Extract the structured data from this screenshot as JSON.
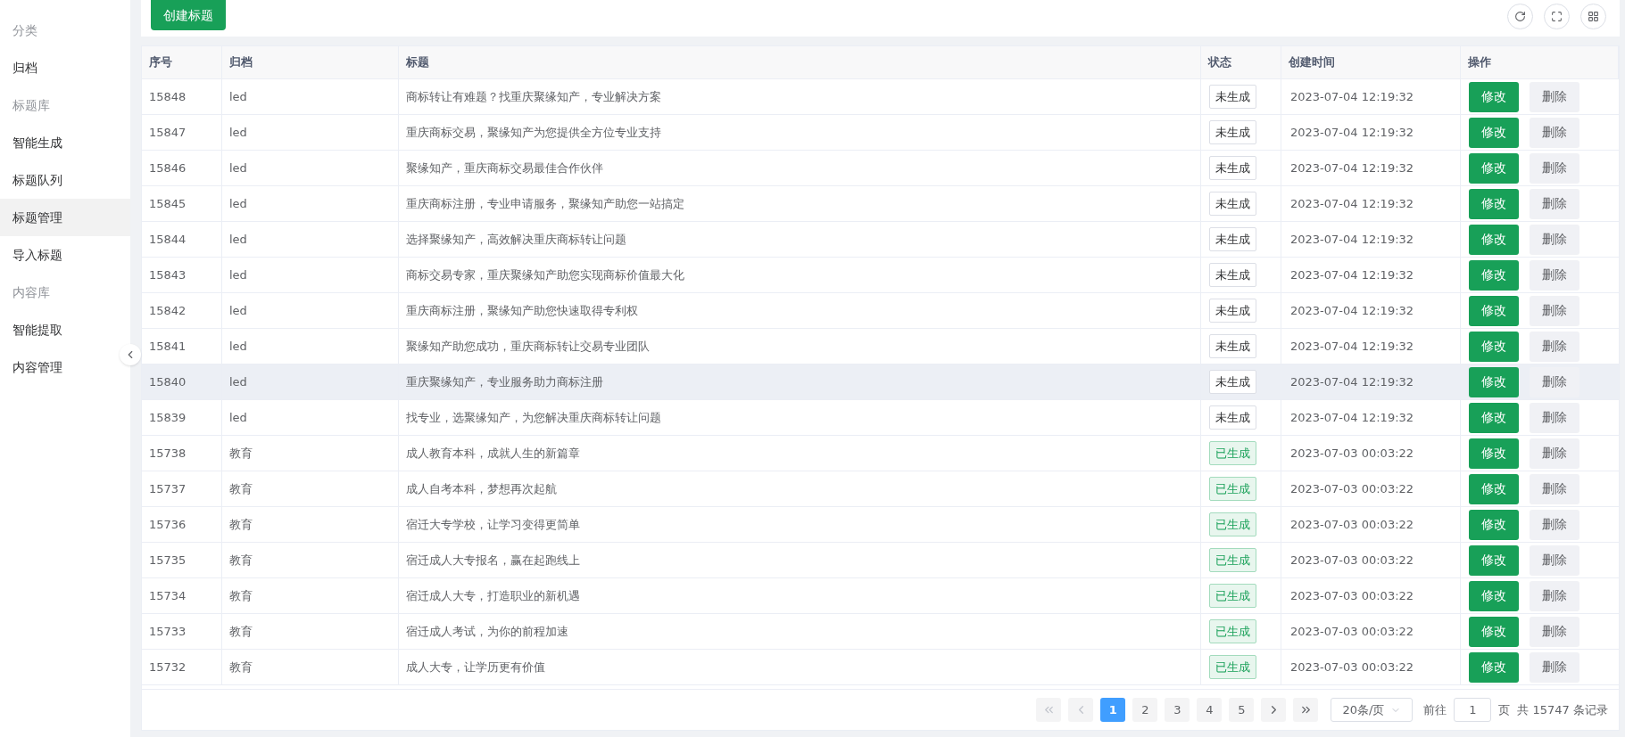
{
  "sidebar": {
    "items": [
      {
        "kind": "group",
        "label": "分类",
        "selected": false
      },
      {
        "kind": "item",
        "label": "归档",
        "selected": false
      },
      {
        "kind": "group",
        "label": "标题库",
        "selected": false
      },
      {
        "kind": "item",
        "label": "智能生成",
        "selected": false
      },
      {
        "kind": "item",
        "label": "标题队列",
        "selected": false
      },
      {
        "kind": "item",
        "label": "标题管理",
        "selected": true
      },
      {
        "kind": "item",
        "label": "导入标题",
        "selected": false
      },
      {
        "kind": "group",
        "label": "内容库",
        "selected": false
      },
      {
        "kind": "item",
        "label": "智能提取",
        "selected": false
      },
      {
        "kind": "item",
        "label": "内容管理",
        "selected": false
      }
    ]
  },
  "toolbar": {
    "create_button": "创建标题"
  },
  "table": {
    "columns": [
      "序号",
      "归档",
      "标题",
      "状态",
      "创建时间",
      "操作"
    ],
    "rows": [
      {
        "id": "15848",
        "archive": "led",
        "title": "商标转让有难题？找重庆聚缘知产，专业解决方案",
        "status": "未生成",
        "generated": false,
        "created": "2023-07-04 12:19:32",
        "edit": "修改",
        "delete": "删除",
        "highlighted": false
      },
      {
        "id": "15847",
        "archive": "led",
        "title": "重庆商标交易，聚缘知产为您提供全方位专业支持",
        "status": "未生成",
        "generated": false,
        "created": "2023-07-04 12:19:32",
        "edit": "修改",
        "delete": "删除",
        "highlighted": false
      },
      {
        "id": "15846",
        "archive": "led",
        "title": "聚缘知产，重庆商标交易最佳合作伙伴",
        "status": "未生成",
        "generated": false,
        "created": "2023-07-04 12:19:32",
        "edit": "修改",
        "delete": "删除",
        "highlighted": false
      },
      {
        "id": "15845",
        "archive": "led",
        "title": "重庆商标注册，专业申请服务，聚缘知产助您一站搞定",
        "status": "未生成",
        "generated": false,
        "created": "2023-07-04 12:19:32",
        "edit": "修改",
        "delete": "删除",
        "highlighted": false
      },
      {
        "id": "15844",
        "archive": "led",
        "title": "选择聚缘知产，高效解决重庆商标转让问题",
        "status": "未生成",
        "generated": false,
        "created": "2023-07-04 12:19:32",
        "edit": "修改",
        "delete": "删除",
        "highlighted": false
      },
      {
        "id": "15843",
        "archive": "led",
        "title": "商标交易专家，重庆聚缘知产助您实现商标价值最大化",
        "status": "未生成",
        "generated": false,
        "created": "2023-07-04 12:19:32",
        "edit": "修改",
        "delete": "删除",
        "highlighted": false
      },
      {
        "id": "15842",
        "archive": "led",
        "title": "重庆商标注册，聚缘知产助您快速取得专利权",
        "status": "未生成",
        "generated": false,
        "created": "2023-07-04 12:19:32",
        "edit": "修改",
        "delete": "删除",
        "highlighted": false
      },
      {
        "id": "15841",
        "archive": "led",
        "title": "聚缘知产助您成功，重庆商标转让交易专业团队",
        "status": "未生成",
        "generated": false,
        "created": "2023-07-04 12:19:32",
        "edit": "修改",
        "delete": "删除",
        "highlighted": false
      },
      {
        "id": "15840",
        "archive": "led",
        "title": "重庆聚缘知产，专业服务助力商标注册",
        "status": "未生成",
        "generated": false,
        "created": "2023-07-04 12:19:32",
        "edit": "修改",
        "delete": "删除",
        "highlighted": true
      },
      {
        "id": "15839",
        "archive": "led",
        "title": "找专业，选聚缘知产，为您解决重庆商标转让问题",
        "status": "未生成",
        "generated": false,
        "created": "2023-07-04 12:19:32",
        "edit": "修改",
        "delete": "删除",
        "highlighted": false
      },
      {
        "id": "15738",
        "archive": "教育",
        "title": "成人教育本科，成就人生的新篇章",
        "status": "已生成",
        "generated": true,
        "created": "2023-07-03 00:03:22",
        "edit": "修改",
        "delete": "删除",
        "highlighted": false
      },
      {
        "id": "15737",
        "archive": "教育",
        "title": "成人自考本科，梦想再次起航",
        "status": "已生成",
        "generated": true,
        "created": "2023-07-03 00:03:22",
        "edit": "修改",
        "delete": "删除",
        "highlighted": false
      },
      {
        "id": "15736",
        "archive": "教育",
        "title": "宿迁大专学校，让学习变得更简单",
        "status": "已生成",
        "generated": true,
        "created": "2023-07-03 00:03:22",
        "edit": "修改",
        "delete": "删除",
        "highlighted": false
      },
      {
        "id": "15735",
        "archive": "教育",
        "title": "宿迁成人大专报名，赢在起跑线上",
        "status": "已生成",
        "generated": true,
        "created": "2023-07-03 00:03:22",
        "edit": "修改",
        "delete": "删除",
        "highlighted": false
      },
      {
        "id": "15734",
        "archive": "教育",
        "title": "宿迁成人大专，打造职业的新机遇",
        "status": "已生成",
        "generated": true,
        "created": "2023-07-03 00:03:22",
        "edit": "修改",
        "delete": "删除",
        "highlighted": false
      },
      {
        "id": "15733",
        "archive": "教育",
        "title": "宿迁成人考试，为你的前程加速",
        "status": "已生成",
        "generated": true,
        "created": "2023-07-03 00:03:22",
        "edit": "修改",
        "delete": "删除",
        "highlighted": false
      },
      {
        "id": "15732",
        "archive": "教育",
        "title": "成人大专，让学历更有价值",
        "status": "已生成",
        "generated": true,
        "created": "2023-07-03 00:03:22",
        "edit": "修改",
        "delete": "删除",
        "highlighted": false
      }
    ]
  },
  "pagination": {
    "pages": [
      {
        "label": "1",
        "selected": true
      },
      {
        "label": "2",
        "selected": false
      },
      {
        "label": "3",
        "selected": false
      },
      {
        "label": "4",
        "selected": false
      },
      {
        "label": "5",
        "selected": false
      }
    ],
    "first_disabled": true,
    "prev_disabled": true,
    "page_size": "20条/页",
    "goto_label": "前往",
    "goto_value": "1",
    "page_unit": "页",
    "total": "共 15747 条记录"
  }
}
